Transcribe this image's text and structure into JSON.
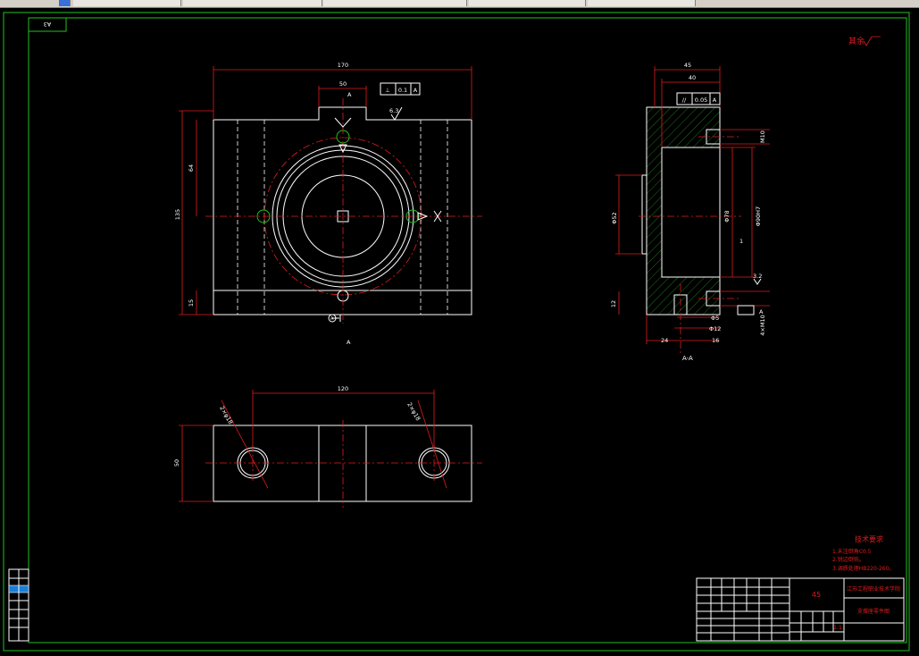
{
  "sheet": {
    "corner_tag": "A3",
    "roughness_note": "其余",
    "roughness_value": "√"
  },
  "front_view": {
    "dims": {
      "width": "170",
      "top_slot": "50",
      "height_total": "135",
      "height_upper": "64",
      "height_lower": "15",
      "roughness": "6.3"
    },
    "tolerance": {
      "symbol": "⊥",
      "value": "0.1",
      "datum": "A"
    },
    "section_marks": [
      "A",
      "A"
    ]
  },
  "top_view": {
    "dims": {
      "width": "120",
      "depth": "50",
      "hole_left": "2×φ18",
      "hole_right": "2×φ18"
    }
  },
  "section_view": {
    "title": "A-A",
    "dims": {
      "w45": "45",
      "w40": "40",
      "d52": "Φ52",
      "d78": "Φ78",
      "d90": "Φ90H7",
      "m10": "M10",
      "d12_left": "12",
      "d5": "Φ5",
      "d12": "Φ12",
      "w24": "24",
      "w16": "16",
      "r1": "1",
      "m10b": "4×M10",
      "ra32": "3.2"
    },
    "tolerance": {
      "symbol": "//",
      "value": "0.05",
      "datum": "A"
    },
    "datum_label": "A"
  },
  "tech_requirements": {
    "title": "技术要求",
    "items": [
      "1.未注倒角C0.5",
      "2.锐边倒钝。",
      "3.调质处理HB220-260。"
    ]
  },
  "title_block": {
    "material": "45",
    "school": "江苏工程职业技术学院",
    "drawing_name": "支撑座零件图",
    "scale": "1:1"
  }
}
